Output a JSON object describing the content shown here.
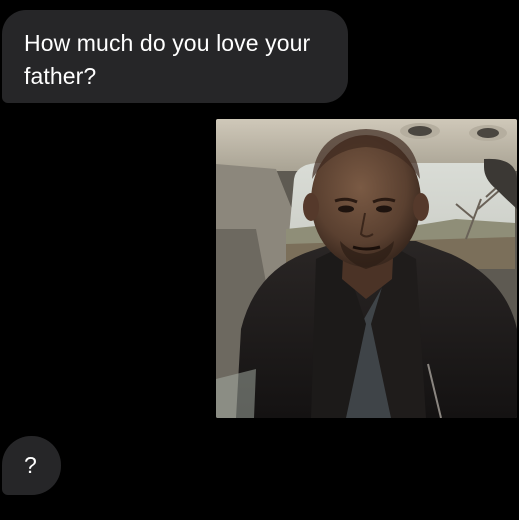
{
  "conversation": {
    "messages": [
      {
        "text": "How much do you love your father?"
      },
      {
        "text": "?"
      }
    ],
    "attachment": {
      "type": "photo",
      "icon": "photo-icon"
    }
  },
  "colors": {
    "background": "#000000",
    "bubble": "#262628",
    "bubble_text": "#ffffff"
  }
}
